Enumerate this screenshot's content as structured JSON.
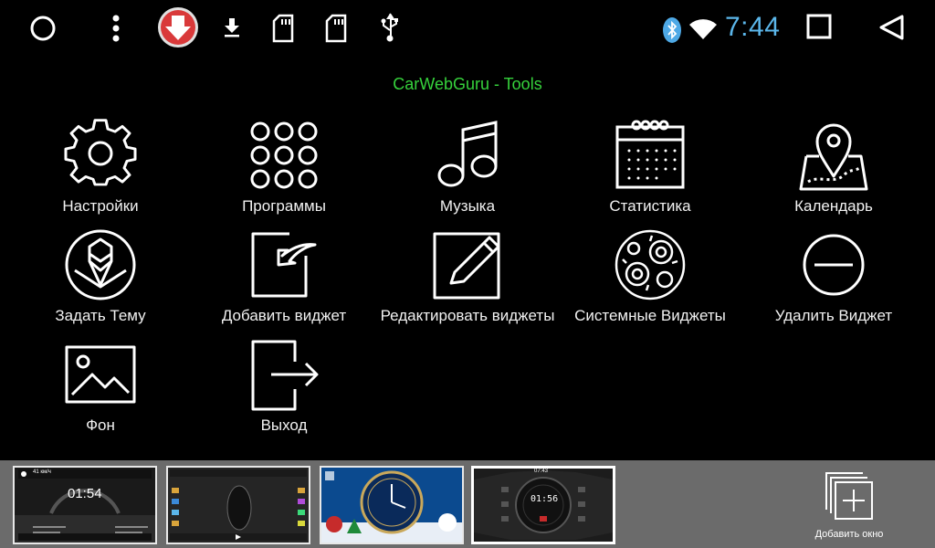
{
  "statusbar": {
    "time": "7:44",
    "icons": [
      "circle-icon",
      "more-vert-icon",
      "download-badge-icon",
      "download-icon",
      "sd-card-icon",
      "sd-card-icon",
      "usb-icon",
      "bluetooth-icon",
      "wifi-icon",
      "square-icon",
      "back-triangle-icon"
    ],
    "accent": "#5bb6ea"
  },
  "title": "CarWebGuru - Tools",
  "title_color": "#36d23c",
  "menu": [
    {
      "label": "Настройки",
      "icon": "gear-icon"
    },
    {
      "label": "Программы",
      "icon": "apps-grid-icon"
    },
    {
      "label": "Музыка",
      "icon": "music-note-icon"
    },
    {
      "label": "Статистика",
      "icon": "calendar-stats-icon"
    },
    {
      "label": "Календарь",
      "icon": "map-pin-icon"
    },
    {
      "label": "Задать Тему",
      "icon": "theme-pencil-icon"
    },
    {
      "label": "Добавить виджет",
      "icon": "add-widget-icon"
    },
    {
      "label": "Редактировать виджеты",
      "icon": "edit-icon"
    },
    {
      "label": "Системные Виджеты",
      "icon": "system-widgets-icon"
    },
    {
      "label": "Удалить Виджет",
      "icon": "minus-circle-icon"
    },
    {
      "label": "Фон",
      "icon": "image-icon"
    },
    {
      "label": "Выход",
      "icon": "exit-icon"
    }
  ],
  "bottombar": {
    "thumb1": {
      "time": "01:54",
      "speed": "41 км/ч"
    },
    "thumb4": {
      "time": "07:43",
      "clock": "01:56"
    },
    "add_window_label": "Добавить окно"
  }
}
